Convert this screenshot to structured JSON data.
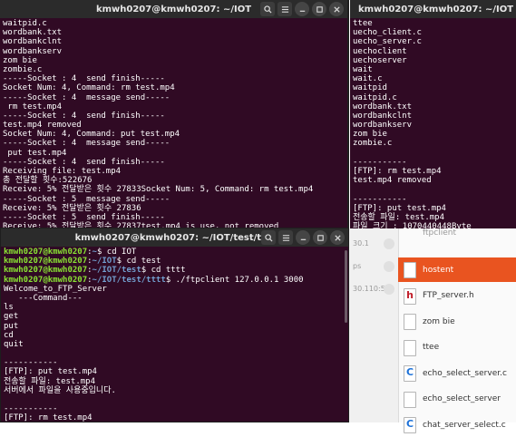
{
  "windows": {
    "top_left": {
      "title": "kmwh0207@kmwh0207: ~/IOT",
      "lines": [
        "waitpid.c",
        "wordbank.txt",
        "wordbankclnt",
        "wordbankserv",
        "zom bie",
        "zombie.c",
        "-----Socket : 4  send finish-----",
        "Socket Num: 4, Command: rm test.mp4",
        "-----Socket : 4  message send-----",
        " rm test.mp4",
        "-----Socket : 4  send finish-----",
        "test.mp4 removed",
        "Socket Num: 4, Command: put test.mp4",
        "-----Socket : 4  message send-----",
        " put test.mp4",
        "-----Socket : 4  send finish-----",
        "Receiving file: test.mp4",
        "총 전달할 횟수:522676",
        "Receive: 5% 전달받은 횟수 27833Socket Num: 5, Command: rm test.mp4",
        "-----Socket : 5  message send-----",
        "Receive: 5% 전달받은 횟수 27836",
        "-----Socket : 5  send finish-----",
        "Receive: 5% 전달받은 횟수 27837test.mp4 is use, not removed",
        "Receive: 20% 전달받은 횟수 102045"
      ]
    },
    "top_right": {
      "title": "kmwh0207@kmwh0207: ~/IOT",
      "lines": [
        "ttee",
        "uecho_client.c",
        "uecho_server.c",
        "uechoclient",
        "uechoserver",
        "wait",
        "wait.c",
        "waitpid",
        "waitpid.c",
        "wordbank.txt",
        "wordbankclnt",
        "wordbankserv",
        "zom bie",
        "zombie.c",
        "",
        "-----------",
        "[FTP]: rm test.mp4",
        "test.mp4 removed",
        "",
        "-----------",
        "[FTP]: put test.mp4",
        "전송할 파일: test.mp4",
        "파일 크기 : 1070440448Byte",
        "진행률 20% 전달한 횟수: 104474"
      ]
    },
    "bottom_left": {
      "title": "kmwh0207@kmwh0207: ~/IOT/test/tttt",
      "prompt_user": "kmwh0207@kmwh0207",
      "prompts": [
        {
          "path": "~",
          "cmd": "$ cd IOT"
        },
        {
          "path": "~/IOT",
          "cmd": "$ cd test"
        },
        {
          "path": "~/IOT/test",
          "cmd": "$ cd tttt"
        },
        {
          "path": "~/IOT/test/tttt",
          "cmd": "$ ./ftpclient 127.0.0.1 3000"
        }
      ],
      "lines": [
        "Welcome_to_FTP_Server",
        "   ---Command---",
        "ls",
        "get",
        "put",
        "cd",
        "quit",
        "",
        "-----------",
        "[FTP]: put test.mp4",
        "전송할 파일: test.mp4",
        "서버에서 파일을 사용중입니다.",
        "",
        "-----------",
        "[FTP]: rm test.mp4",
        "test.mp4 is not removed"
      ]
    }
  },
  "file_manager": {
    "left_rows": [
      {
        "text": "30.1",
        "icon": "download-icon"
      },
      {
        "text": "ps",
        "icon": "download-icon"
      },
      {
        "text": "30.110:5",
        "icon": "download-icon"
      }
    ],
    "partial_top": "ftpclient",
    "items": [
      {
        "name": "ftpclient",
        "icon": "generic-file-icon",
        "glyph": "",
        "glyph_color": "#777777",
        "selected": false
      },
      {
        "name": "hostent",
        "icon": "generic-file-icon",
        "glyph": "",
        "glyph_color": "#777777",
        "selected": true
      },
      {
        "name": "FTP_server.h",
        "icon": "h-header-file-icon",
        "glyph": "h",
        "glyph_color": "#c01c28",
        "selected": false
      },
      {
        "name": "zom bie",
        "icon": "generic-file-icon",
        "glyph": "",
        "glyph_color": "#777777",
        "selected": false
      },
      {
        "name": "ttee",
        "icon": "generic-file-icon",
        "glyph": "",
        "glyph_color": "#777777",
        "selected": false
      },
      {
        "name": "echo_select_server.c",
        "icon": "c-source-file-icon",
        "glyph": "C",
        "glyph_color": "#1c71d8",
        "selected": false
      },
      {
        "name": "echo_select_server",
        "icon": "generic-file-icon",
        "glyph": "",
        "glyph_color": "#777777",
        "selected": false
      },
      {
        "name": "chat_server_select.c",
        "icon": "c-source-file-icon",
        "glyph": "C",
        "glyph_color": "#1c71d8",
        "selected": false
      }
    ]
  },
  "colors": {
    "terminal_bg": "#300a24",
    "prompt_user": "#8ae234",
    "prompt_path": "#729fcf",
    "selection": "#e95420"
  }
}
